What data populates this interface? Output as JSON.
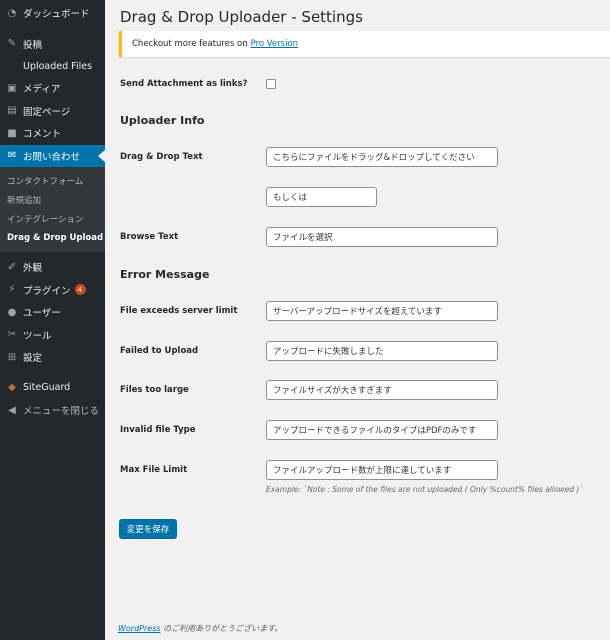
{
  "sidebar": {
    "items": [
      {
        "icon": "dashboard-icon",
        "label": "ダッシュボード"
      },
      {
        "icon": "pin-icon",
        "label": "投稿"
      }
    ],
    "sub_top": "Uploaded Files",
    "items2": [
      {
        "icon": "media-icon",
        "label": "メディア"
      },
      {
        "icon": "page-icon",
        "label": "固定ページ"
      },
      {
        "icon": "comment-icon",
        "label": "コメント"
      },
      {
        "icon": "mail-icon",
        "label": "お問い合わせ"
      }
    ],
    "submenu": [
      "コンタクトフォーム",
      "新規追加",
      "インテグレーション",
      "Drag & Drop Upload"
    ],
    "items3": [
      {
        "icon": "brush-icon",
        "label": "外観"
      },
      {
        "icon": "plugin-icon",
        "label": "プラグイン",
        "badge": "4"
      },
      {
        "icon": "user-icon",
        "label": "ユーザー"
      },
      {
        "icon": "wrench-icon",
        "label": "ツール"
      },
      {
        "icon": "settings-icon",
        "label": "設定"
      }
    ],
    "siteguard": "SiteGuard",
    "collapse": "メニューを閉じる"
  },
  "page": {
    "title": "Drag & Drop Uploader - Settings",
    "notice_text": "Checkout more features on",
    "notice_link": "Pro Version"
  },
  "form": {
    "send_attachment_label": "Send Attachment as links?",
    "uploader_info_heading": "Uploader Info",
    "drag_drop_label": "Drag & Drop Text",
    "drag_drop_value": "こちらにファイルをドラッグ&ドロップしてください",
    "or_value": "もしくは",
    "browse_label": "Browse Text",
    "browse_value": "ファイルを選択",
    "error_heading": "Error Message",
    "exceeds_label": "File exceeds server limit",
    "exceeds_value": "サーバーアップロードサイズを超えています",
    "failed_label": "Failed to Upload",
    "failed_value": "アップロードに失敗しました",
    "too_large_label": "Files too large",
    "too_large_value": "ファイルサイズが大きすぎます",
    "invalid_label": "Invalid file Type",
    "invalid_value": "アップロードできるファイルのタイプはPDFのみです",
    "max_label": "Max File Limit",
    "max_value": "ファイルアップロード数が上限に達しています",
    "example": "Example: `Note : Some of the files are not uploaded ( Only %count% files allowed )`",
    "save_label": "変更を保存"
  },
  "footer": {
    "link": "WordPress",
    "text": " のご利用ありがとうございます。"
  },
  "colors": {
    "sidebar_bg": "#23282d",
    "accent": "#0073aa",
    "notice_border": "#ffb900",
    "badge": "#ca4a1f"
  }
}
